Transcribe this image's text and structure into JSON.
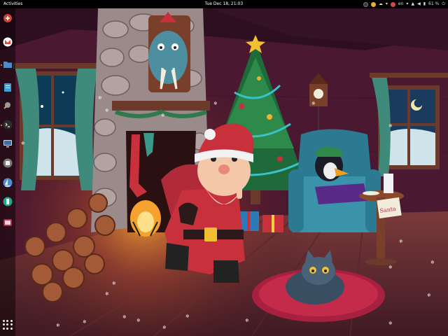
{
  "topbar": {
    "activities_label": "Activities",
    "clock": "Tue Dec 18, 21:03",
    "keyboard_layout": "en",
    "battery_percent": "61 %"
  },
  "dock": {
    "items": [
      {
        "icon": "ubuntu-software-icon",
        "color": "#c8453a"
      },
      {
        "icon": "gmail-icon",
        "color": "#d94c3d"
      },
      {
        "icon": "files-icon",
        "color": "#4a8ecf"
      },
      {
        "icon": "text-editor-icon",
        "color": "#3aa0d8"
      },
      {
        "icon": "settings-tool-icon",
        "color": "#555555"
      },
      {
        "icon": "terminal-icon",
        "color": "#2d2d2d"
      },
      {
        "icon": "vm-monitor-icon",
        "color": "#3b6ea8"
      },
      {
        "icon": "puzzle-icon",
        "color": "#7a7a7a"
      },
      {
        "icon": "sailboat-icon",
        "color": "#4a8fd8"
      },
      {
        "icon": "screen-recorder-icon",
        "color": "#1fa88b"
      },
      {
        "icon": "video-icon",
        "color": "#b0304a"
      }
    ],
    "show_apps": "show-applications-icon"
  },
  "wallpaper": {
    "sign_text": "Santa"
  }
}
